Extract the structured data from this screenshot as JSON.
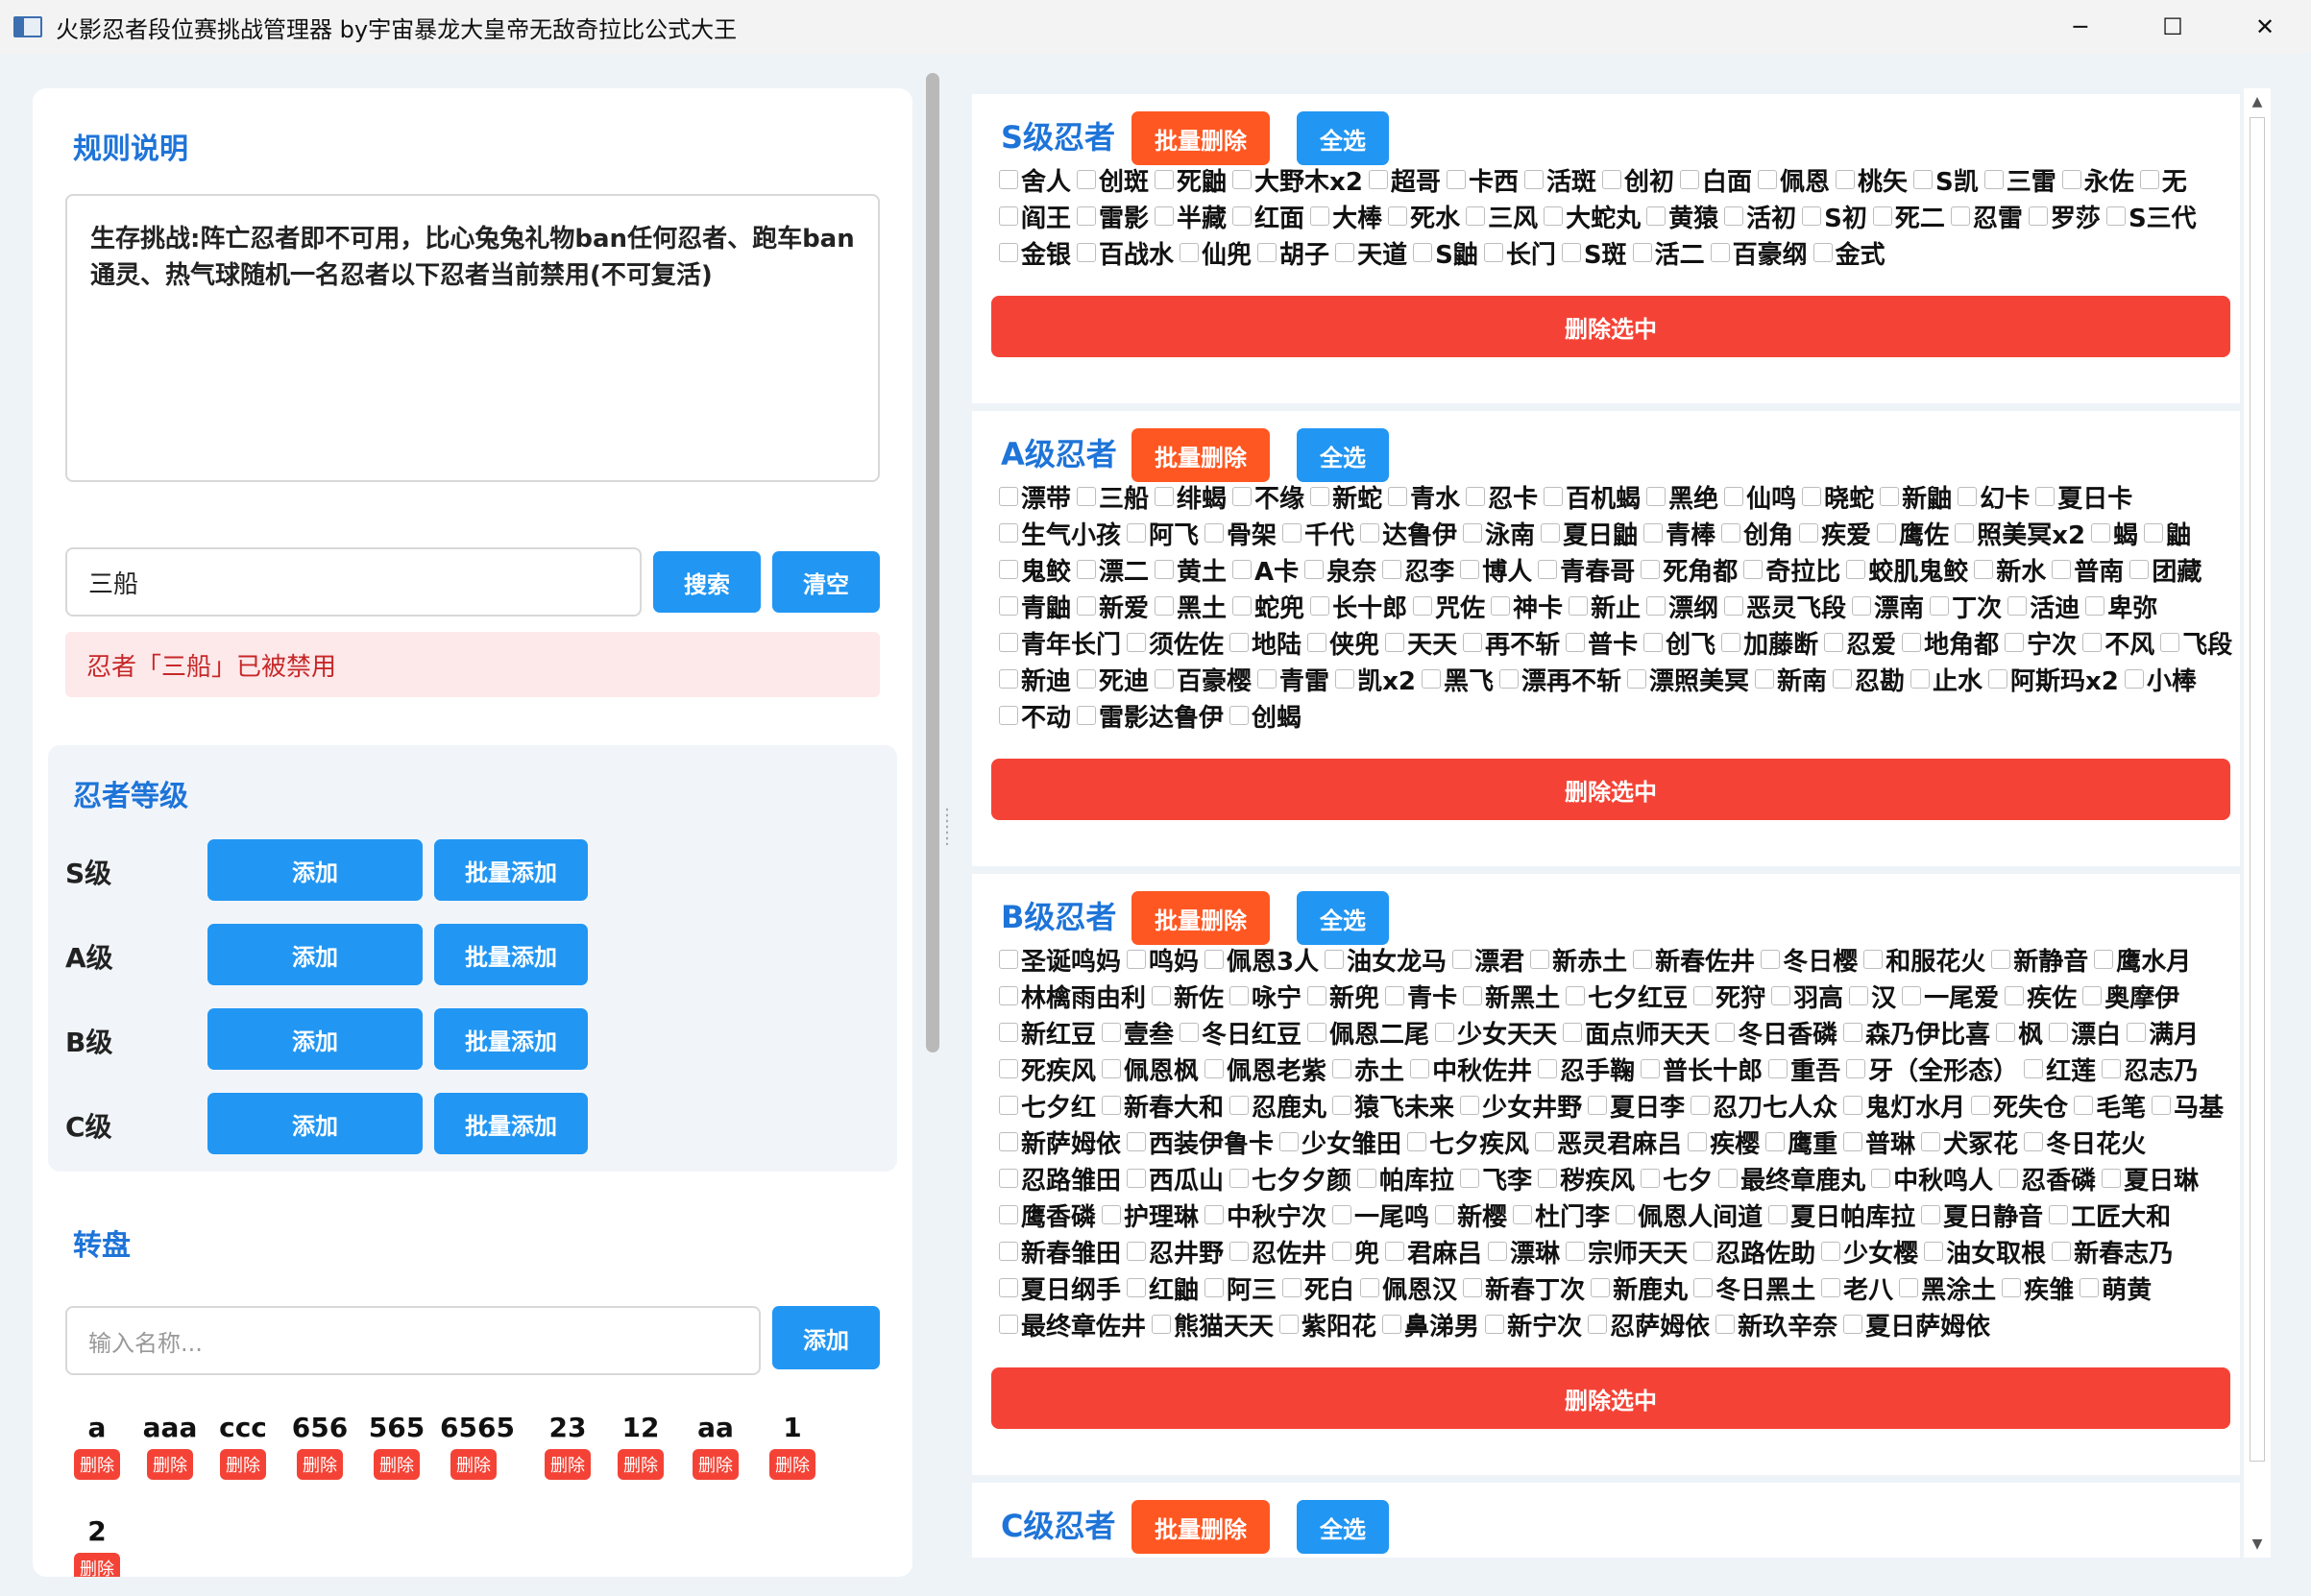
{
  "window": {
    "title": "火影忍者段位赛挑战管理器 by宇宙暴龙大皇帝无敌奇拉比公式大王",
    "minimize": "─",
    "maximize": "☐",
    "close": "✕"
  },
  "rules": {
    "title": "规则说明",
    "text": "生存挑战:阵亡忍者即不可用，比心兔兔礼物ban任何忍者、跑车ban通灵、热气球随机一名忍者以下忍者当前禁用(不可复活)"
  },
  "search": {
    "value": "三船",
    "search_label": "搜索",
    "clear_label": "清空",
    "alert": "忍者「三船」已被禁用"
  },
  "levels": {
    "title": "忍者等级",
    "add_label": "添加",
    "batch_add_label": "批量添加",
    "items": [
      "S级",
      "A级",
      "B级",
      "C级"
    ]
  },
  "wheel": {
    "title": "转盘",
    "placeholder": "输入名称...",
    "add_label": "添加",
    "delete_label": "删除",
    "items": [
      "a",
      "aaa",
      "ccc",
      "656",
      "565",
      "6565",
      "23",
      "12",
      "aa",
      "1",
      "2"
    ]
  },
  "tiers": [
    {
      "title": "S级忍者",
      "batch_delete": "批量删除",
      "select_all": "全选",
      "delete_selected": "删除选中",
      "rows": [
        [
          "舍人",
          "创斑",
          "死鼬",
          "大野木x2",
          "超哥",
          "卡西",
          "活斑",
          "创初",
          "白面",
          "佩恩",
          "桃矢",
          "S凯",
          "三雷",
          "永佐",
          "无"
        ],
        [
          "阎王",
          "雷影",
          "半藏",
          "红面",
          "大棒",
          "死水",
          "三风",
          "大蛇丸",
          "黄猿",
          "活初",
          "S初",
          "死二",
          "忍雷",
          "罗莎",
          "S三代"
        ],
        [
          "金银",
          "百战水",
          "仙兜",
          "胡子",
          "天道",
          "S鼬",
          "长门",
          "S斑",
          "活二",
          "百豪纲",
          "金式"
        ]
      ]
    },
    {
      "title": "A级忍者",
      "batch_delete": "批量删除",
      "select_all": "全选",
      "delete_selected": "删除选中",
      "rows": [
        [
          "漂带",
          "三船",
          "绯蝎",
          "不缘",
          "新蛇",
          "青水",
          "忍卡",
          "百机蝎",
          "黑绝",
          "仙鸣",
          "晓蛇",
          "新鼬",
          "幻卡",
          "夏日卡"
        ],
        [
          "生气小孩",
          "阿飞",
          "骨架",
          "千代",
          "达鲁伊",
          "泳南",
          "夏日鼬",
          "青棒",
          "创角",
          "疾爱",
          "鹰佐",
          "照美冥x2",
          "蝎",
          "鼬"
        ],
        [
          "鬼鲛",
          "漂二",
          "黄土",
          "A卡",
          "泉奈",
          "忍李",
          "博人",
          "青春哥",
          "死角都",
          "奇拉比",
          "蛟肌鬼鲛",
          "新水",
          "普南",
          "团藏"
        ],
        [
          "青鼬",
          "新爱",
          "黑土",
          "蛇兜",
          "长十郎",
          "咒佐",
          "神卡",
          "新止",
          "漂纲",
          "恶灵飞段",
          "漂南",
          "丁次",
          "活迪",
          "卑弥"
        ],
        [
          "青年长门",
          "须佐佐",
          "地陆",
          "侠兜",
          "天天",
          "再不斩",
          "普卡",
          "创飞",
          "加藤断",
          "忍爱",
          "地角都",
          "宁次",
          "不风",
          "飞段"
        ],
        [
          "新迪",
          "死迪",
          "百豪樱",
          "青雷",
          "凯x2",
          "黑飞",
          "漂再不斩",
          "漂照美冥",
          "新南",
          "忍勘",
          "止水",
          "阿斯玛x2",
          "小棒"
        ],
        [
          "不动",
          "雷影达鲁伊",
          "创蝎"
        ]
      ]
    },
    {
      "title": "B级忍者",
      "batch_delete": "批量删除",
      "select_all": "全选",
      "delete_selected": "删除选中",
      "rows": [
        [
          "圣诞鸣妈",
          "鸣妈",
          "佩恩3人",
          "油女龙马",
          "漂君",
          "新赤土",
          "新春佐井",
          "冬日樱",
          "和服花火",
          "新静音",
          "鹰水月"
        ],
        [
          "林檎雨由利",
          "新佐",
          "咏宁",
          "新兜",
          "青卡",
          "新黑土",
          "七夕红豆",
          "死狩",
          "羽高",
          "汉",
          "一尾爱",
          "疾佐",
          "奥摩伊"
        ],
        [
          "新红豆",
          "壹叁",
          "冬日红豆",
          "佩恩二尾",
          "少女天天",
          "面点师天天",
          "冬日香磷",
          "森乃伊比喜",
          "枫",
          "漂白",
          "满月"
        ],
        [
          "死疾风",
          "佩恩枫",
          "佩恩老紫",
          "赤土",
          "中秋佐井",
          "忍手鞠",
          "普长十郎",
          "重吾",
          "牙（全形态）",
          "红莲",
          "忍志乃"
        ],
        [
          "七夕红",
          "新春大和",
          "忍鹿丸",
          "猿飞未来",
          "少女井野",
          "夏日李",
          "忍刀七人众",
          "鬼灯水月",
          "死失仓",
          "毛笔",
          "马基"
        ],
        [
          "新萨姆依",
          "西装伊鲁卡",
          "少女雏田",
          "七夕疾风",
          "恶灵君麻吕",
          "疾樱",
          "鹰重",
          "普琳",
          "犬冢花",
          "冬日花火"
        ],
        [
          "忍路雏田",
          "西瓜山",
          "七夕夕颜",
          "帕库拉",
          "飞李",
          "秽疾风",
          "七夕",
          "最终章鹿丸",
          "中秋鸣人",
          "忍香磷",
          "夏日琳"
        ],
        [
          "鹰香磷",
          "护理琳",
          "中秋宁次",
          "一尾鸣",
          "新樱",
          "杜门李",
          "佩恩人间道",
          "夏日帕库拉",
          "夏日静音",
          "工匠大和"
        ],
        [
          "新春雏田",
          "忍井野",
          "忍佐井",
          "兜",
          "君麻吕",
          "漂琳",
          "宗师天天",
          "忍路佐助",
          "少女樱",
          "油女取根",
          "新春志乃"
        ],
        [
          "夏日纲手",
          "红鼬",
          "阿三",
          "死白",
          "佩恩汉",
          "新春丁次",
          "新鹿丸",
          "冬日黑土",
          "老八",
          "黑涂土",
          "疾雏",
          "萌黄"
        ],
        [
          "最终章佐井",
          "熊猫天天",
          "紫阳花",
          "鼻涕男",
          "新宁次",
          "忍萨姆依",
          "新玖辛奈",
          "夏日萨姆依"
        ]
      ]
    },
    {
      "title": "C级忍者",
      "batch_delete": "批量删除",
      "select_all": "全选",
      "delete_selected": "删除选中",
      "rows": []
    }
  ]
}
